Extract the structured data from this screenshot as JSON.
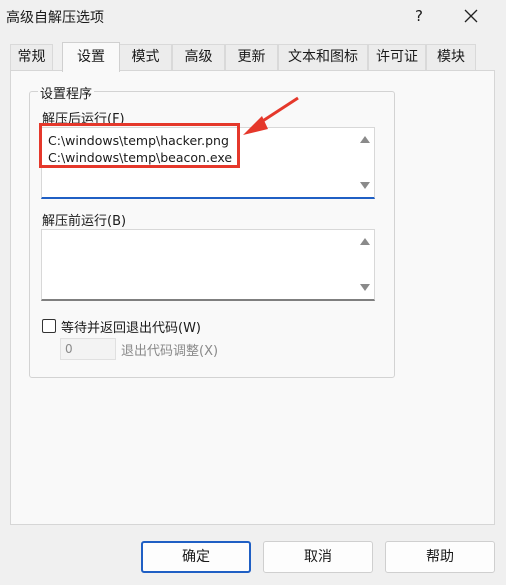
{
  "window": {
    "title": "高级自解压选项",
    "help": "?"
  },
  "tabs": [
    {
      "label": "常规"
    },
    {
      "label": "设置",
      "active": true
    },
    {
      "label": "模式"
    },
    {
      "label": "高级"
    },
    {
      "label": "更新"
    },
    {
      "label": "文本和图标"
    },
    {
      "label": "许可证"
    },
    {
      "label": "模块"
    }
  ],
  "setup": {
    "group_title": "设置程序",
    "after_label": "解压后运行(F)",
    "after_lines": [
      "C:\\windows\\temp\\hacker.png",
      "C:\\windows\\temp\\beacon.exe"
    ],
    "before_label": "解压前运行(B)",
    "wait_label": "等待并返回退出代码(W)",
    "exit_code_value": "0",
    "exit_code_label": "退出代码调整(X)"
  },
  "annotation": {
    "color": "#e5382b"
  },
  "buttons": {
    "ok": "确定",
    "cancel": "取消",
    "help": "帮助"
  },
  "colors": {
    "accent": "#1f5fc4"
  }
}
